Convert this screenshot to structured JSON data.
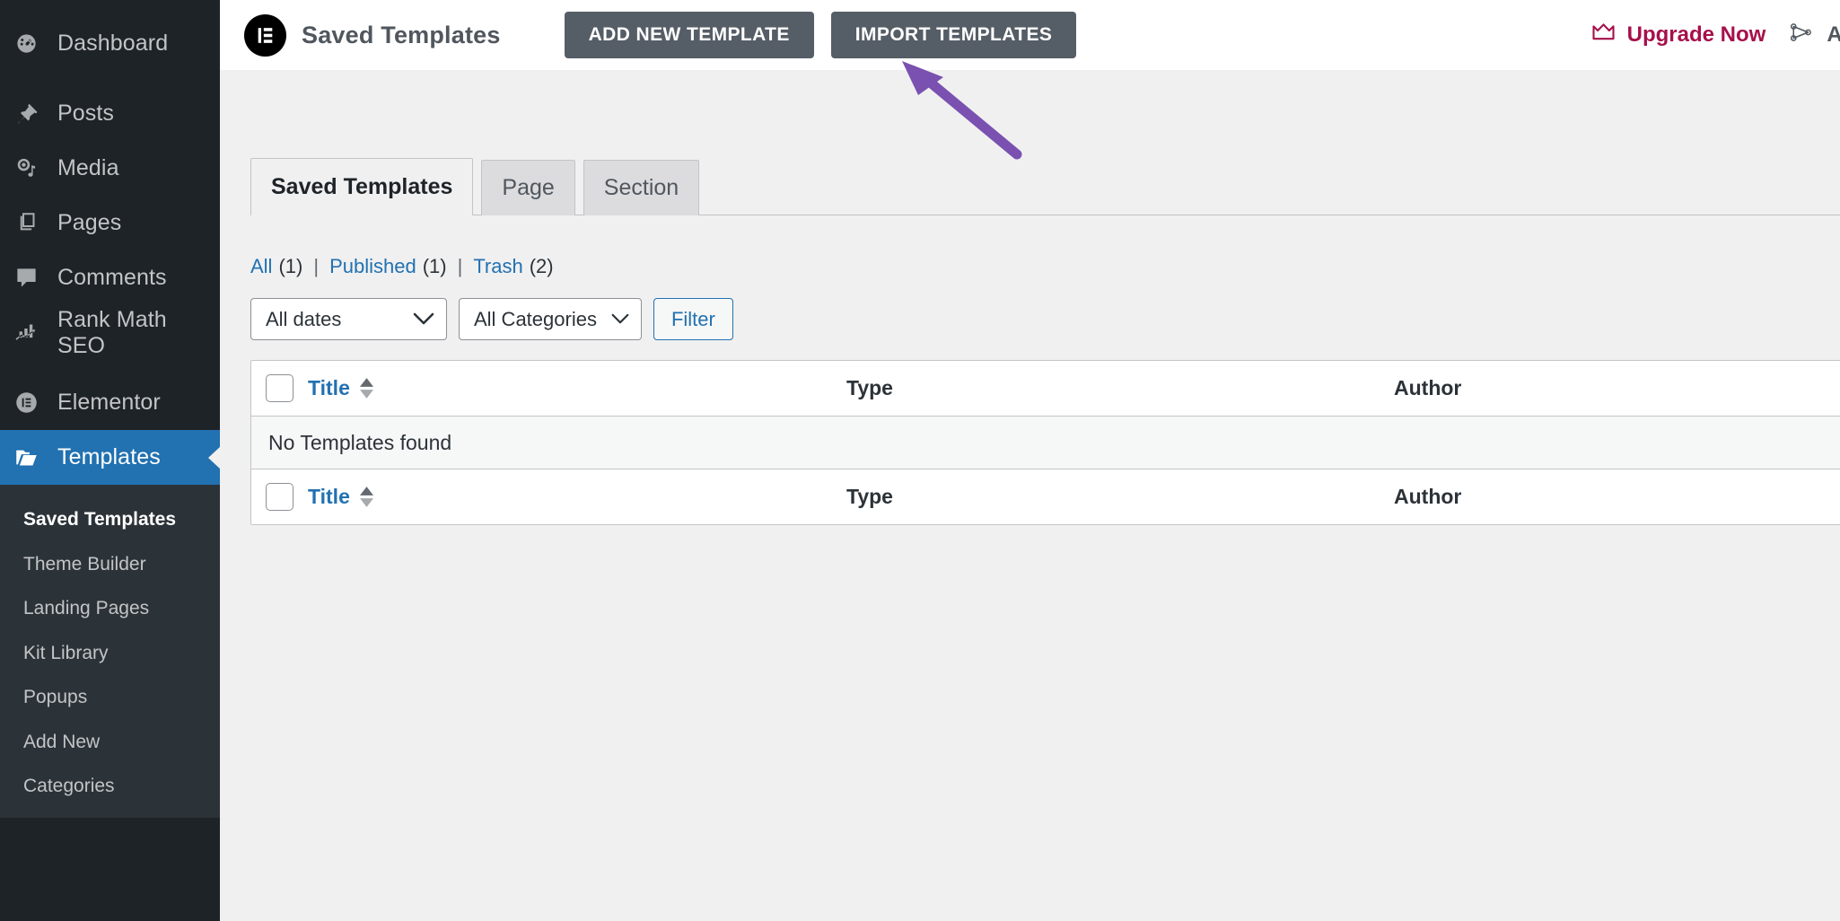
{
  "sidebar": {
    "items": [
      {
        "label": "Dashboard",
        "icon": "dashboard-icon",
        "active": false
      },
      {
        "label": "Posts",
        "icon": "pin-icon",
        "active": false
      },
      {
        "label": "Media",
        "icon": "media-icon",
        "active": false
      },
      {
        "label": "Pages",
        "icon": "pages-icon",
        "active": false
      },
      {
        "label": "Comments",
        "icon": "comments-icon",
        "active": false
      },
      {
        "label": "Rank Math SEO",
        "icon": "rank-math-icon",
        "active": false
      },
      {
        "label": "Elementor",
        "icon": "elementor-icon",
        "active": false
      },
      {
        "label": "Templates",
        "icon": "folder-icon",
        "active": true
      }
    ],
    "submenu": [
      {
        "label": "Saved Templates",
        "current": true
      },
      {
        "label": "Theme Builder",
        "current": false
      },
      {
        "label": "Landing Pages",
        "current": false
      },
      {
        "label": "Kit Library",
        "current": false
      },
      {
        "label": "Popups",
        "current": false
      },
      {
        "label": "Add New",
        "current": false
      },
      {
        "label": "Categories",
        "current": false
      }
    ]
  },
  "topbar": {
    "brand_title": "Saved Templates",
    "add_new_label": "ADD NEW TEMPLATE",
    "import_label": "IMPORT TEMPLATES",
    "upgrade_label": "Upgrade Now",
    "addons_label": "Add-"
  },
  "tabs": [
    {
      "label": "Saved Templates",
      "active": true
    },
    {
      "label": "Page",
      "active": false
    },
    {
      "label": "Section",
      "active": false
    }
  ],
  "status_filters": {
    "all_label": "All",
    "all_count": "(1)",
    "published_label": "Published",
    "published_count": "(1)",
    "trash_label": "Trash",
    "trash_count": "(2)",
    "divider": "|"
  },
  "tablenav": {
    "dates_value": "All dates",
    "categories_value": "All Categories",
    "filter_label": "Filter"
  },
  "table": {
    "columns": {
      "title": "Title",
      "type": "Type",
      "author": "Author"
    },
    "empty_message": "No Templates found"
  },
  "colors": {
    "sidebar_bg": "#1d2327",
    "submenu_bg": "#2c3338",
    "active_blue": "#2271b1",
    "content_bg": "#f0f0f1",
    "button_gray": "#555d66",
    "upgrade_crimson": "#a6104b",
    "arrow_purple": "#7a51b0"
  }
}
